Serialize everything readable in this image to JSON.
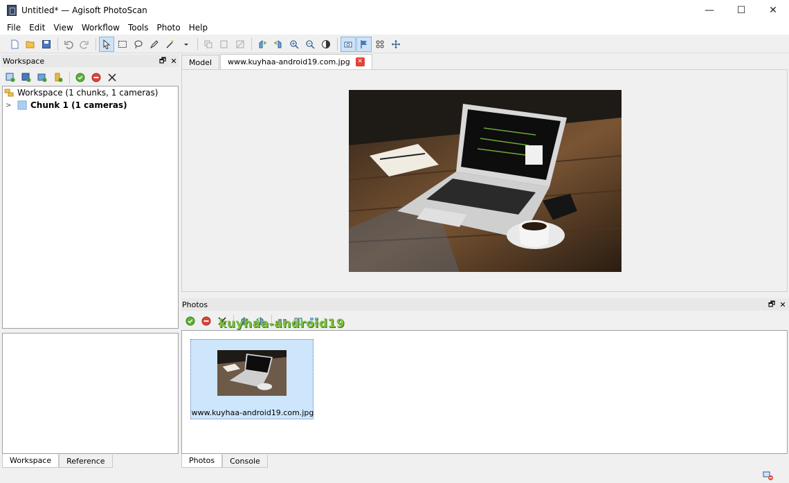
{
  "window": {
    "title": "Untitled* — Agisoft PhotoScan",
    "minimize": "—",
    "maximize": "☐",
    "close": "✕"
  },
  "menu": [
    "File",
    "Edit",
    "View",
    "Workflow",
    "Tools",
    "Photo",
    "Help"
  ],
  "workspace": {
    "title": "Workspace",
    "tree": {
      "root": "Workspace (1 chunks, 1 cameras)",
      "chunk": "Chunk 1 (1 cameras)"
    },
    "tabs": [
      "Workspace",
      "Reference"
    ]
  },
  "viewer": {
    "tabs": [
      "Model",
      "www.kuyhaa-android19.com.jpg"
    ],
    "close_glyph": "✕"
  },
  "photos": {
    "title": "Photos",
    "items": [
      {
        "label": "www.kuyhaa-android19.com.jpg"
      }
    ],
    "tabs": [
      "Photos",
      "Console"
    ]
  },
  "panel_controls": {
    "float": "🗗",
    "close": "✕"
  },
  "watermark": "kuyhaa-android19",
  "colors": {
    "selection": "#cde6fb",
    "close_red": "#e0443a",
    "add_green": "#7dc242"
  }
}
